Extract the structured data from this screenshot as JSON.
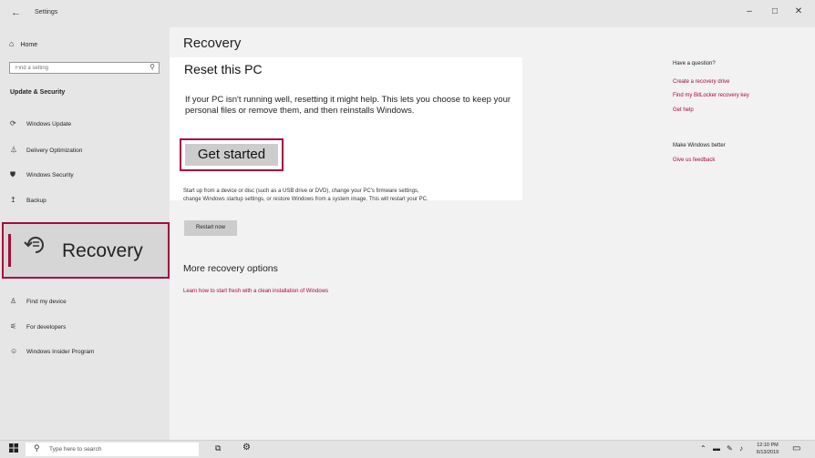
{
  "window": {
    "title": "Settings",
    "back_glyph": "←",
    "controls": {
      "minimize": "–",
      "maximize": "□",
      "close": "✕"
    }
  },
  "sidebar": {
    "home": {
      "label": "Home",
      "icon": "home-icon"
    },
    "search": {
      "placeholder": "Find a setting",
      "icon": "search-icon"
    },
    "section_title": "Update & Security",
    "items": [
      {
        "label": "Windows Update",
        "icon": "sync-icon"
      },
      {
        "label": "Delivery Optimization",
        "icon": "delivery-optimization-icon"
      },
      {
        "label": "Windows Security",
        "icon": "shield-icon"
      },
      {
        "label": "Backup",
        "icon": "backup-icon"
      },
      {
        "label": "Recovery",
        "icon": "recovery-icon",
        "selected": true
      },
      {
        "label": "Find my device",
        "icon": "person-pin-icon"
      },
      {
        "label": "For developers",
        "icon": "developer-icon"
      },
      {
        "label": "Windows Insider Program",
        "icon": "insider-icon"
      }
    ]
  },
  "main": {
    "title": "Recovery",
    "reset": {
      "title": "Reset this PC",
      "description": "If your PC isn't running well, resetting it might help. This lets you choose to keep your personal files or remove them, and then reinstalls Windows.",
      "button_label": "Get started"
    },
    "advanced_startup": {
      "description": "Start up from a device or disc (such as a USB drive or DVD), change your PC's firmware settings, change Windows startup settings, or restore Windows from a system image. This will restart your PC.",
      "button_label": "Restart now"
    },
    "more": {
      "title": "More recovery options",
      "link": "Learn how to start fresh with a clean installation of Windows"
    }
  },
  "right_panel": {
    "question_heading": "Have a question?",
    "links": [
      "Create a recovery drive",
      "Find my BitLocker recovery key",
      "Get help"
    ],
    "better_heading": "Make Windows better",
    "feedback_link": "Give us feedback"
  },
  "taskbar": {
    "search_placeholder": "Type here to search",
    "time": "12:10 PM",
    "date": "6/13/2019"
  },
  "colors": {
    "accent": "#a60a3d",
    "sidebar_bg": "#e6e6e6",
    "content_bg": "#f2f2f2"
  }
}
